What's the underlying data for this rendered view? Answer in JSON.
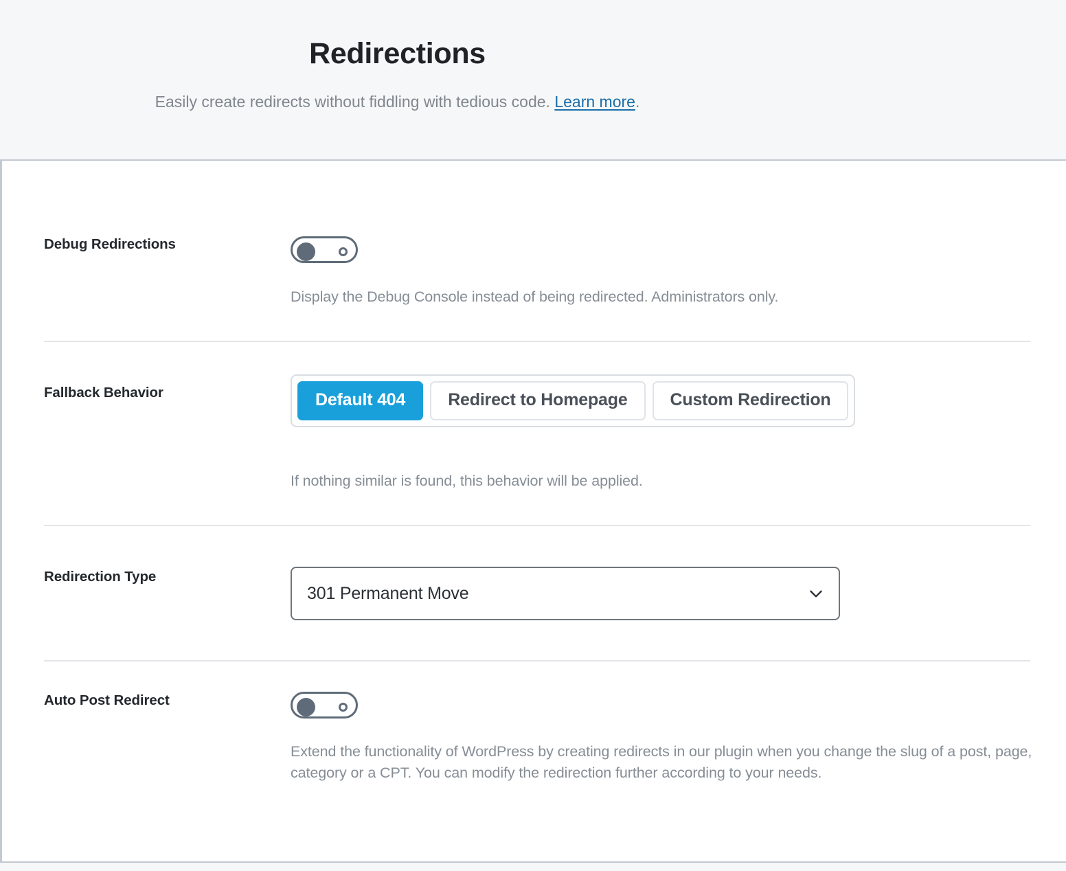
{
  "header": {
    "title": "Redirections",
    "subtitle_before": "Easily create redirects without fiddling with tedious code. ",
    "link_label": "Learn more",
    "subtitle_after": "."
  },
  "theme": {
    "accent_blue": "#19a0db",
    "link_blue": "#1a6fa8",
    "label_color": "#23282d",
    "help_color": "#868d95",
    "header_bg": "#f6f7f8",
    "panel_bg": "#ffffff",
    "border_gray": "#c3c9d2",
    "divider_gray": "#e3e5e8",
    "toggle_gray": "#5f6b78"
  },
  "rows": {
    "debug_redirections": {
      "label": "Debug Redirections",
      "toggle_state": "off",
      "help": "Display the Debug Console instead of being redirected. Administrators only."
    },
    "fallback_behavior": {
      "label": "Fallback Behavior",
      "options": [
        {
          "label": "Default 404",
          "selected": true
        },
        {
          "label": "Redirect to Homepage",
          "selected": false
        },
        {
          "label": "Custom Redirection",
          "selected": false
        }
      ],
      "help": "If nothing similar is found, this behavior will be applied."
    },
    "redirection_type": {
      "label": "Redirection Type",
      "selected_value": "301 Permanent Move",
      "chevron_icon": "chevron-down-icon"
    },
    "auto_post_redirect": {
      "label": "Auto Post Redirect",
      "toggle_state": "off",
      "help": "Extend the functionality of WordPress by creating redirects in our plugin when you change the slug of a post, page, category or a CPT. You can modify the redirection further according to your needs."
    }
  }
}
